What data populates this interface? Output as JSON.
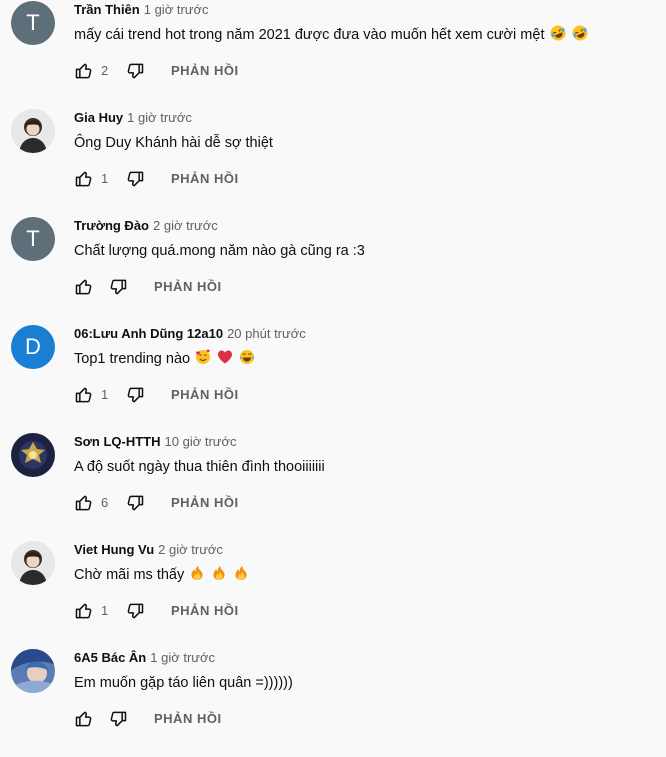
{
  "reply_label": "PHẢN HỒI",
  "comments": [
    {
      "author": "Trần Thiên",
      "time": "1 giờ trước",
      "text": "mấy cái trend hot trong năm 2021 được đưa vào muốn hết xem cười mệt",
      "emojis": [
        "rolling-laughing",
        "rolling-laughing"
      ],
      "likes": "2",
      "avatar": {
        "type": "letter",
        "letter": "T",
        "color": "#5f6f7a"
      }
    },
    {
      "author": "Gia Huy",
      "time": "1 giờ trước",
      "text": "Ông Duy Khánh hài dễ sợ thiệt",
      "emojis": [],
      "likes": "1",
      "avatar": {
        "type": "photo",
        "icon": "person-photo"
      }
    },
    {
      "author": "Trường Đào",
      "time": "2 giờ trước",
      "text": "Chất lượng quá.mong năm nào gà cũng ra :3",
      "emojis": [],
      "likes": "",
      "avatar": {
        "type": "letter",
        "letter": "T",
        "color": "#5f6f7a"
      }
    },
    {
      "author": "06:Lưu Anh Dũng 12a10",
      "time": "20 phút trước",
      "text": "Top1 trending nào",
      "emojis": [
        "smiling-face-with-hearts",
        "red-heart",
        "tears-of-joy"
      ],
      "likes": "1",
      "avatar": {
        "type": "letter",
        "letter": "D",
        "color": "#1a7fd4"
      }
    },
    {
      "author": "Sơn LQ-HTTH",
      "time": "10 giờ trước",
      "text": "A độ suốt ngày thua thiên đình thooiiiiiii",
      "emojis": [],
      "likes": "6",
      "avatar": {
        "type": "photo",
        "icon": "game-emblem-photo"
      }
    },
    {
      "author": "Viet Hung Vu",
      "time": "2 giờ trước",
      "text": "Chờ mãi ms thấy",
      "emojis": [
        "fire",
        "fire",
        "fire"
      ],
      "likes": "1",
      "avatar": {
        "type": "photo",
        "icon": "person-photo"
      }
    },
    {
      "author": "6A5 Bác Ân",
      "time": "1 giờ trước",
      "text": "Em muốn gặp táo liên quân =))))))",
      "emojis": [],
      "likes": "",
      "avatar": {
        "type": "photo",
        "icon": "anime-photo"
      }
    }
  ]
}
